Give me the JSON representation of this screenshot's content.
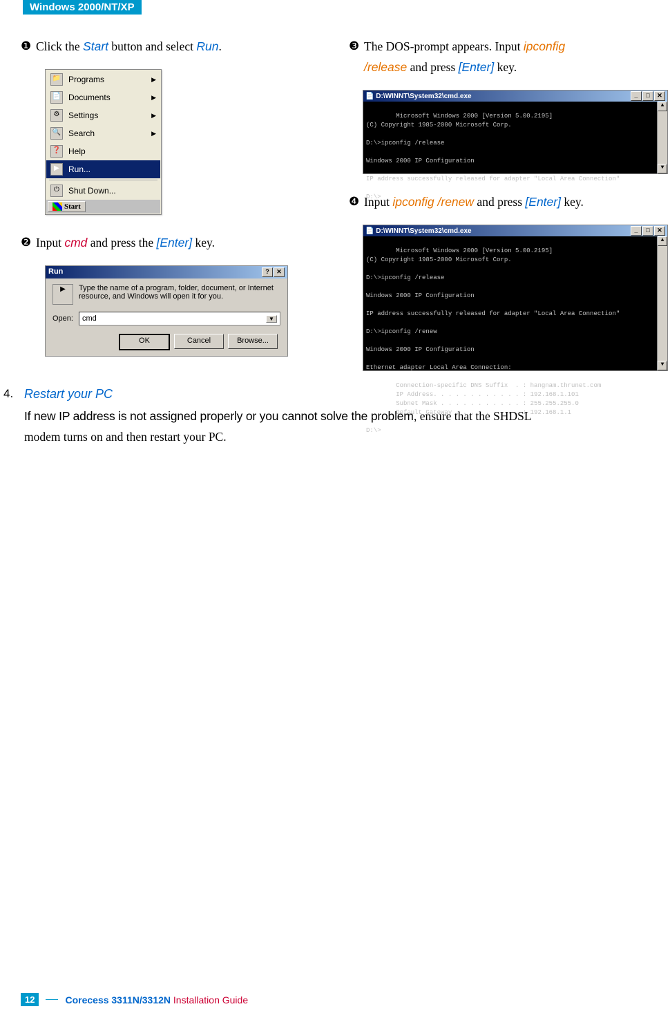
{
  "header": {
    "tab": "Windows 2000/NT/XP"
  },
  "steps": {
    "s1": {
      "num": "❶",
      "parts": [
        "Click the ",
        "Start",
        " button and select ",
        "Run",
        "."
      ]
    },
    "s2": {
      "num": "❷",
      "parts": [
        "Input ",
        "cmd",
        " and press the ",
        "[Enter]",
        " key."
      ]
    },
    "s3": {
      "num": "❸",
      "parts1": [
        "The  DOS-prompt  appears.  Input  ",
        "ipconfig"
      ],
      "parts2": [
        "/release",
        " and press ",
        "[Enter]",
        " key."
      ]
    },
    "s4": {
      "num": "❹",
      "parts": [
        "Input ",
        "ipconfig /renew",
        " and press ",
        "[Enter]",
        " key."
      ]
    }
  },
  "startmenu": {
    "items": [
      {
        "icon": "📁",
        "label": "Programs",
        "arrow": "▶"
      },
      {
        "icon": "📄",
        "label": "Documents",
        "arrow": "▶"
      },
      {
        "icon": "⚙",
        "label": "Settings",
        "arrow": "▶"
      },
      {
        "icon": "🔍",
        "label": "Search",
        "arrow": "▶"
      },
      {
        "icon": "❓",
        "label": "Help",
        "arrow": ""
      },
      {
        "icon": "▶",
        "label": "Run...",
        "arrow": "",
        "selected": true
      },
      {
        "icon": "⏻",
        "label": "Shut Down...",
        "arrow": ""
      }
    ],
    "startbtn": "Start"
  },
  "rundialog": {
    "title": "Run",
    "close_help": "?",
    "close_x": "✕",
    "desc": "Type the name of a program, folder, document, or Internet resource, and Windows will open it for you.",
    "open_label": "Open:",
    "value": "cmd",
    "btn_ok": "OK",
    "btn_cancel": "Cancel",
    "btn_browse": "Browse..."
  },
  "cmd1": {
    "title": "D:\\WINNT\\System32\\cmd.exe",
    "lines": "Microsoft Windows 2000 [Version 5.00.2195]\n(C) Copyright 1985-2000 Microsoft Corp.\n\nD:\\>ipconfig /release\n\nWindows 2000 IP Configuration\n\nIP address successfully released for adapter \"Local Area Connection\"\n\nD:\\>"
  },
  "cmd2": {
    "title": "D:\\WINNT\\System32\\cmd.exe",
    "lines": "Microsoft Windows 2000 [Version 5.00.2195]\n(C) Copyright 1985-2000 Microsoft Corp.\n\nD:\\>ipconfig /release\n\nWindows 2000 IP Configuration\n\nIP address successfully released for adapter \"Local Area Connection\"\n\nD:\\>ipconfig /renew\n\nWindows 2000 IP Configuration\n\nEthernet adapter Local Area Connection:\n\n        Connection-specific DNS Suffix  . : hangnam.thrunet.com\n        IP Address. . . . . . . . . . . . : 192.168.1.101\n        Subnet Mask . . . . . . . . . . . : 255.255.255.0\n        Default Gateway . . . . . . . . . : 192.168.1.1\n\nD:\\>"
  },
  "section4": {
    "num": "4.",
    "title": "Restart your PC",
    "cond": "If new IP address is not assigned properly or you cannot solve the problem,",
    "rest1": " ensure that the SHDSL",
    "rest2": "modem turns on and then restart your PC."
  },
  "footer": {
    "page": "12",
    "product": "Corecess 3311N/3312N",
    "guide": " Installation Guide"
  }
}
